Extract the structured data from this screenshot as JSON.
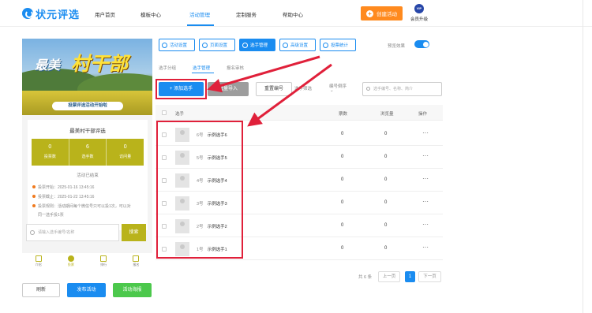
{
  "brand": {
    "name": "状元评选"
  },
  "nav": {
    "items": [
      "用户首页",
      "模板中心",
      "活动管理",
      "定制服务",
      "帮助中心"
    ],
    "active": "活动管理",
    "create_label": "创建活动",
    "vip_badge": "VIP",
    "vip_label": "会员升级"
  },
  "preview": {
    "banner_small": "最美",
    "banner_big": "村干部",
    "banner_ribbon": "投票评选活动开始啦",
    "card_title": "最美村干部评选",
    "stats": [
      {
        "num": "0",
        "label": "投票数"
      },
      {
        "num": "6",
        "label": "选手数"
      },
      {
        "num": "0",
        "label": "访问量"
      }
    ],
    "status": "活动已结束",
    "info": [
      "投票开始：2025-01-16 13:45:16",
      "投票截止：2025-01-22 13:45:16",
      "投票规则：活动期间每个微信号只可以投1次，可以对",
      "同一选手投1票"
    ],
    "search_placeholder": "请输入选手编号/名称",
    "search_button": "搜索",
    "tabs": [
      "介绍",
      "投票",
      "排行",
      "报名"
    ],
    "active_tab": "投票"
  },
  "bottom_buttons": {
    "refresh": "刷新",
    "publish": "发布活动",
    "poster": "活动海报"
  },
  "toolbar": {
    "buttons": [
      "活动设置",
      "页面设置",
      "选手管理",
      "高级设置",
      "投票统计"
    ],
    "active": "选手管理",
    "toggle_label": "预览效果"
  },
  "subtabs": {
    "items": [
      "选手分组",
      "选手管理",
      "报名审核"
    ],
    "active": "选手管理"
  },
  "actions": {
    "add": "+ 添加选手",
    "batch": "批量导入",
    "reset_numbers": "重置编号",
    "filter": "选手筛选",
    "sort_label": "编号倒序",
    "search_placeholder": "选手编号、名称、简介"
  },
  "table": {
    "headers": [
      "选手",
      "票数",
      "浏览量",
      "操作"
    ],
    "rows": [
      {
        "no": "6号",
        "name": "示例选手6",
        "votes": "0",
        "views": "0",
        "ops": "···"
      },
      {
        "no": "5号",
        "name": "示例选手5",
        "votes": "0",
        "views": "0",
        "ops": "···"
      },
      {
        "no": "4号",
        "name": "示例选手4",
        "votes": "0",
        "views": "0",
        "ops": "···"
      },
      {
        "no": "3号",
        "name": "示例选手3",
        "votes": "0",
        "views": "0",
        "ops": "···"
      },
      {
        "no": "2号",
        "name": "示例选手2",
        "votes": "0",
        "views": "0",
        "ops": "···"
      },
      {
        "no": "1号",
        "name": "示例选手1",
        "votes": "0",
        "views": "0",
        "ops": "···"
      }
    ]
  },
  "pagination": {
    "total": "共 6 条",
    "prev": "上一页",
    "current": "1",
    "next": "下一页"
  },
  "colors": {
    "accent": "#1a8cf0",
    "orange": "#ff8a1e",
    "olive": "#b9b31b",
    "highlight": "#e0203a"
  }
}
